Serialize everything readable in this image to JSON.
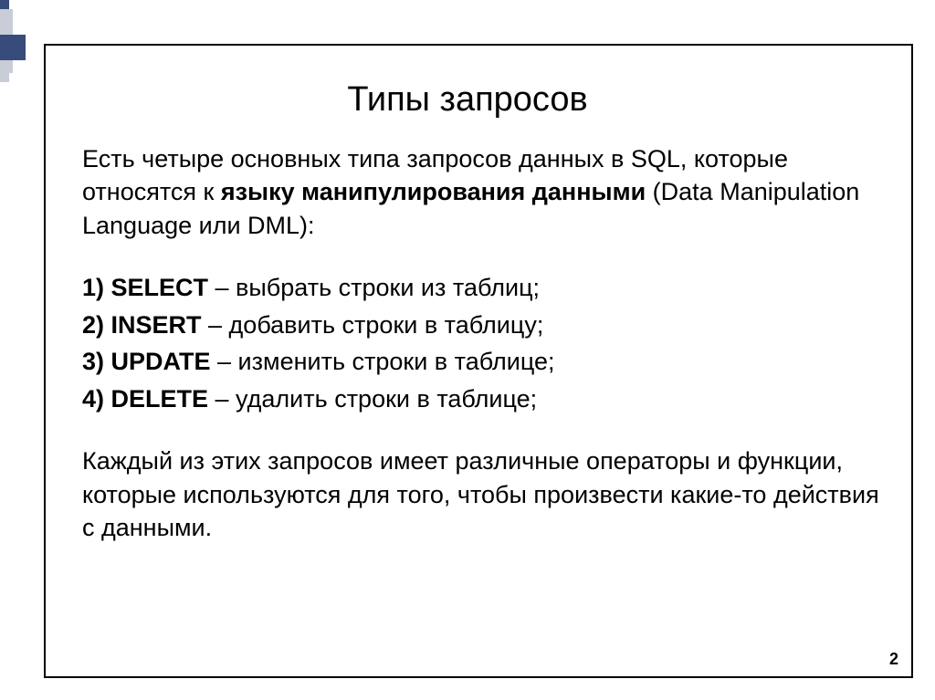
{
  "title": "Типы запросов",
  "intro_part1": "Есть четыре основных типа запросов данных в SQL, которые относятся к ",
  "intro_bold": "языку манипулирования данными",
  "intro_part2": " (Data Manipulation Language или DML):",
  "items": [
    {
      "num": "1) ",
      "term": "SELECT",
      "desc": " – выбрать строки из таблиц;"
    },
    {
      "num": "2) ",
      "term": "INSERT",
      "desc": " – добавить строки в таблицу;"
    },
    {
      "num": "3) ",
      "term": "UPDATE",
      "desc": " – изменить строки в таблице;"
    },
    {
      "num": "4) ",
      "term": "DELETE",
      "desc": " – удалить строки в таблице;"
    }
  ],
  "outro": "Каждый из этих запросов имеет различные операторы и функции, которые используются для того, чтобы произвести какие-то действия с данными.",
  "page_number": "2"
}
